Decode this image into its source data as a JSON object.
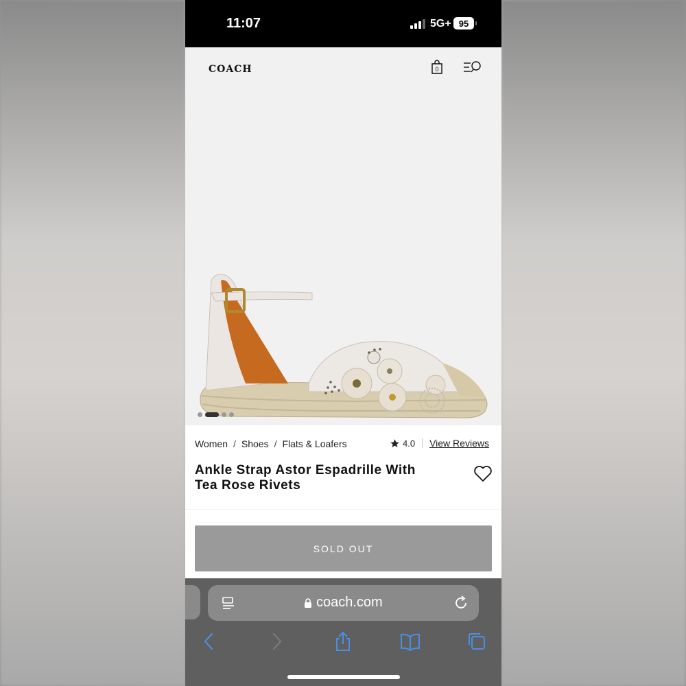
{
  "status_bar": {
    "time": "11:07",
    "network": "5G+",
    "battery": "95"
  },
  "header": {
    "logo": "COACH",
    "bag_count": "0"
  },
  "gallery": {
    "image_count": 4,
    "active_index": 1
  },
  "breadcrumb": [
    "Women",
    "Shoes",
    "Flats & Loafers"
  ],
  "rating": {
    "value": "4.0",
    "reviews_link": "View Reviews"
  },
  "product": {
    "title_line1": "Ankle Strap Astor Espadrille With",
    "title_line2": "Tea Rose Rivets",
    "cta": "SOLD OUT"
  },
  "browser": {
    "url": "coach.com"
  },
  "colors": {
    "sold_out_bg": "#9a9a9a",
    "safari_blue": "#4a8fe6"
  }
}
